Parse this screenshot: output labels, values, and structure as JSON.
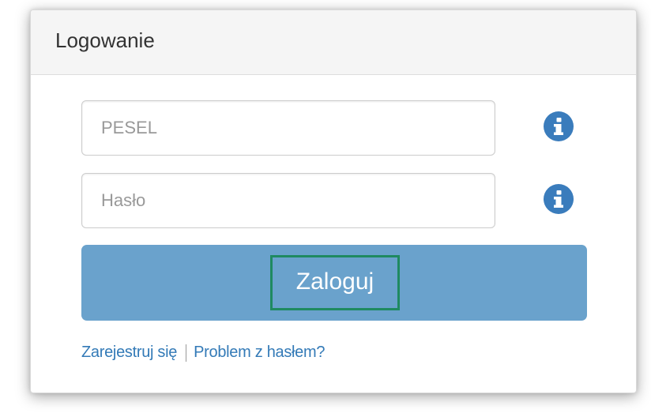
{
  "panel": {
    "title": "Logowanie"
  },
  "form": {
    "pesel_placeholder": "PESEL",
    "password_placeholder": "Hasło",
    "pesel_value": "",
    "password_value": "",
    "submit_label": "Zaloguj"
  },
  "links": {
    "register": "Zarejestruj się",
    "password_problem": "Problem z hasłem?"
  },
  "icons": {
    "info": "info-circle-icon"
  },
  "colors": {
    "button": "#6aa2cc",
    "info_icon": "#3a7cbc",
    "link": "#337ab7",
    "focus_outline": "#1f8a61",
    "header_bg": "#f5f5f5"
  }
}
